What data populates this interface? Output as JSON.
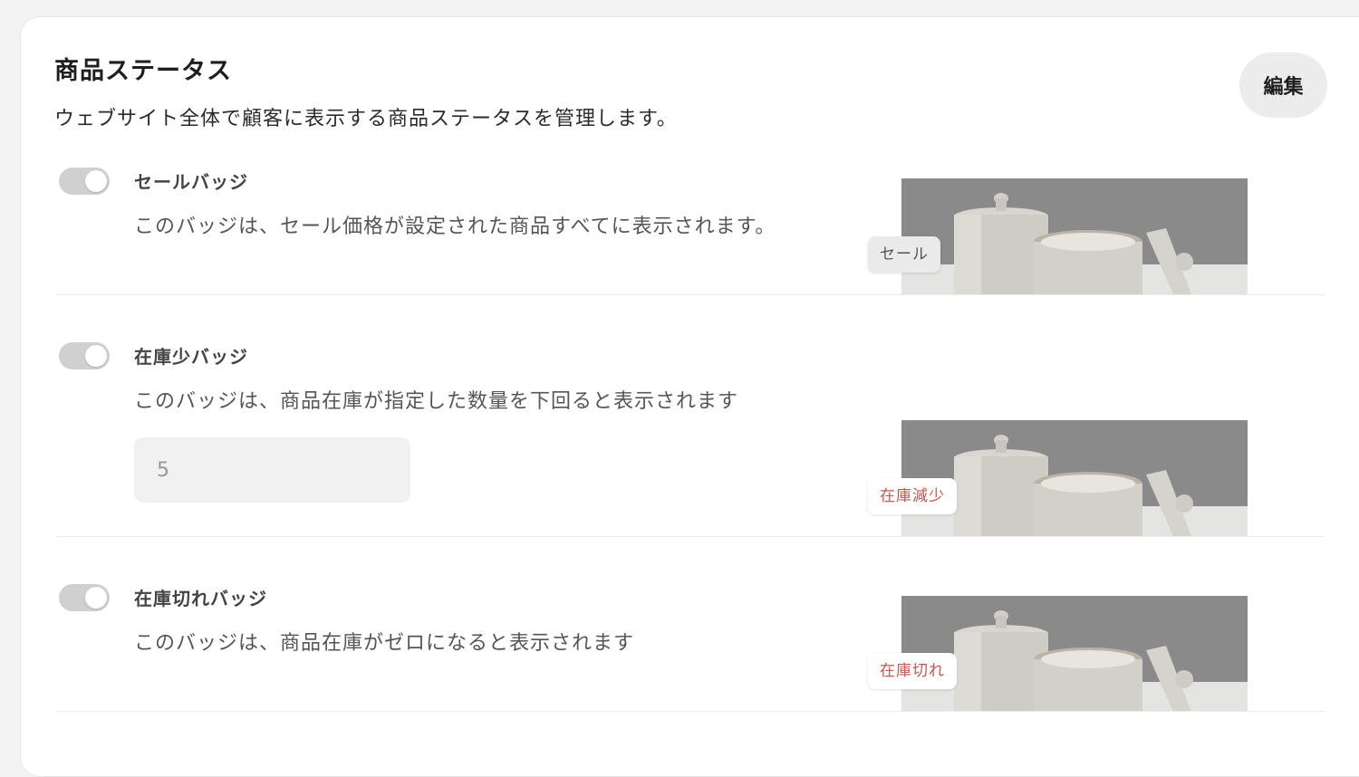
{
  "header": {
    "title": "商品ステータス",
    "description": "ウェブサイト全体で顧客に表示する商品ステータスを管理します。",
    "edit_label": "編集"
  },
  "badges": [
    {
      "title": "セールバッジ",
      "description": "このバッジは、セール価格が設定された商品すべてに表示されます。",
      "enabled": true,
      "preview_label": "セール"
    },
    {
      "title": "在庫少バッジ",
      "description": "このバッジは、商品在庫が指定した数量を下回ると表示されます",
      "enabled": true,
      "threshold_value": "5",
      "preview_label": "在庫減少"
    },
    {
      "title": "在庫切れバッジ",
      "description": "このバッジは、商品在庫がゼロになると表示されます",
      "enabled": true,
      "preview_label": "在庫切れ"
    }
  ],
  "colors": {
    "toggle_track": "#d0d0d0",
    "stock_badge_text": "#c4574d",
    "sale_badge_bg": "#eaeaea"
  }
}
